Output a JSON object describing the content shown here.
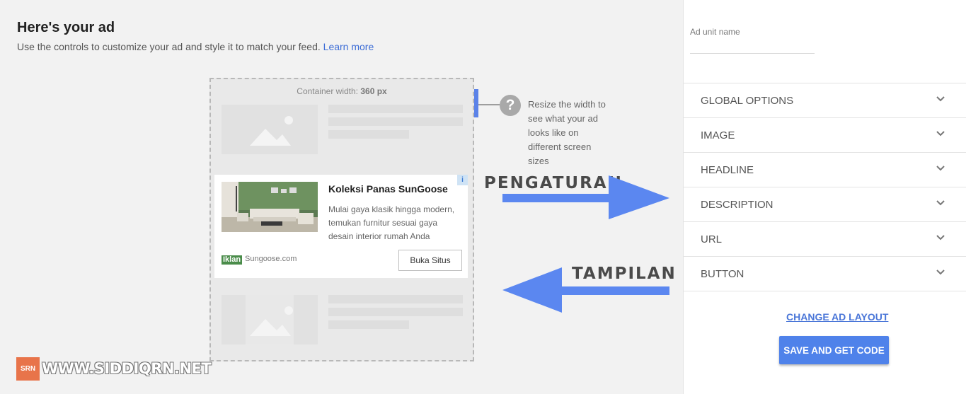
{
  "header": {
    "title": "Here's your ad",
    "subtitle": "Use the controls to customize your ad and style it to match your feed.",
    "learn_more": "Learn more"
  },
  "preview": {
    "container_width_label": "Container width:",
    "container_width_value": "360 px",
    "resize_hint": "Resize the width to see what your ad looks like on different screen sizes"
  },
  "ad": {
    "headline": "Koleksi Panas SunGoose",
    "description": "Mulai gaya klasik hingga modern, temukan furnitur sesuai gaya desain interior rumah Anda",
    "badge": "Iklan",
    "domain": "Sungoose.com",
    "button": "Buka Situs"
  },
  "annotations": {
    "settings": "PENGATURAN",
    "display": "TAMPILAN"
  },
  "watermark": {
    "badge": "SRN",
    "text": "WWW.SIDDIQRN.NET"
  },
  "panel": {
    "ad_unit_name_label": "Ad unit name",
    "ad_unit_name_value": "",
    "sections": [
      {
        "label": "GLOBAL OPTIONS"
      },
      {
        "label": "IMAGE"
      },
      {
        "label": "HEADLINE"
      },
      {
        "label": "DESCRIPTION"
      },
      {
        "label": "URL"
      },
      {
        "label": "BUTTON"
      }
    ],
    "change_layout": "CHANGE AD LAYOUT",
    "save_button": "SAVE AND GET CODE"
  },
  "colors": {
    "accent": "#4f82ea",
    "arrow": "#5b87f0",
    "link": "#3c6cd6",
    "badge_green": "#4a8c4a",
    "watermark_orange": "#e8744a"
  },
  "icons": [
    "help-icon",
    "image-placeholder-icon",
    "adchoices-icon",
    "chevron-down-icon",
    "arrow-right-icon",
    "arrow-left-icon"
  ]
}
